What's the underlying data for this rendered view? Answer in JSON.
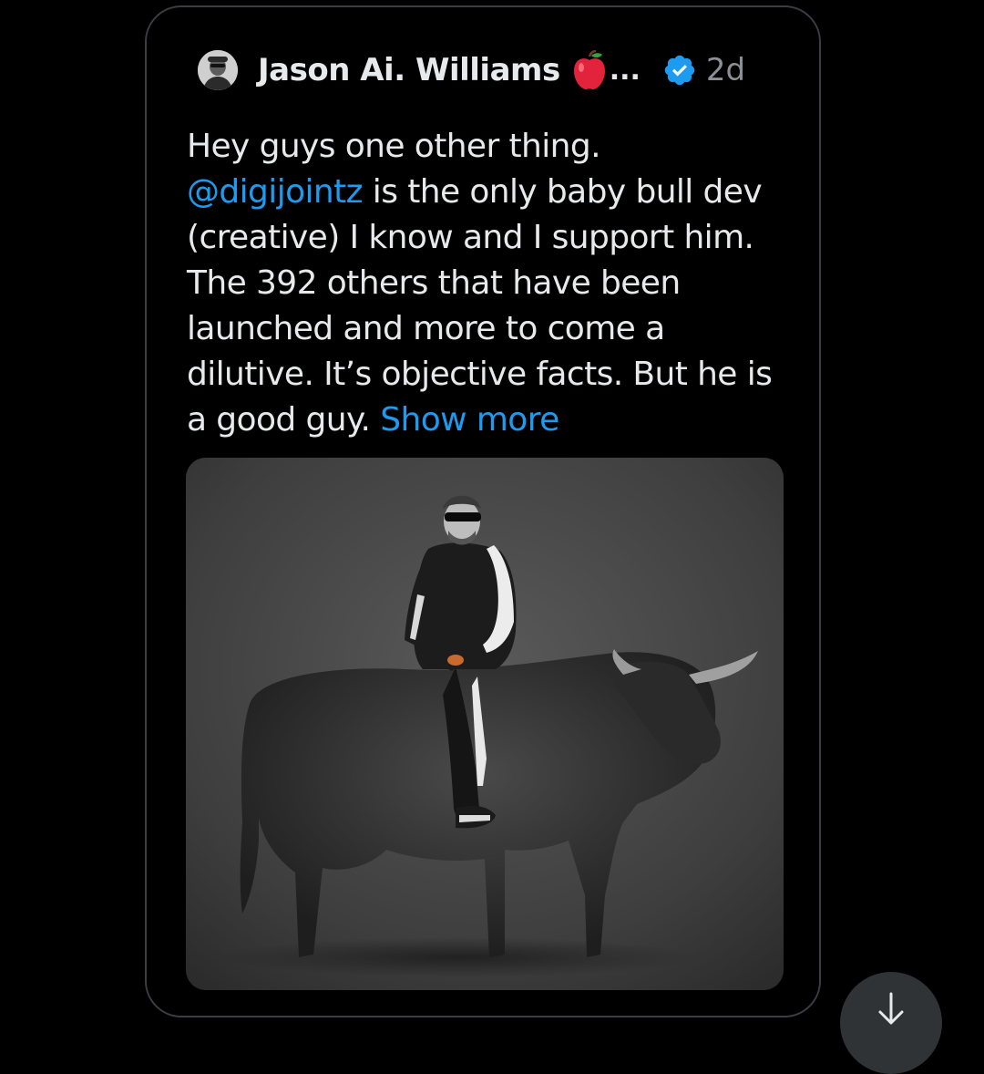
{
  "quote": {
    "author_name": "Jason Ai. Williams",
    "author_emoji": "apple-emoji",
    "truncation": "...",
    "verified_icon": "verified-badge-icon",
    "timestamp": "2d",
    "text_before_mention": "Hey guys one other thing.",
    "mention": "@digijointz",
    "text_after_mention": " is the only baby bull dev (creative) I know and I support him. The 392 others that have been launched and more to come a dilutive.  It’s objective facts. But he is a good guy. ",
    "show_more": "Show more"
  },
  "colors": {
    "background": "#000000",
    "card_border": "#3a3d42",
    "text": "#e7e9ea",
    "muted": "#8b9096",
    "link": "#1d9bf0",
    "verified": "#1d9bf0"
  },
  "scroll_button": {
    "icon": "arrow-down-icon"
  }
}
